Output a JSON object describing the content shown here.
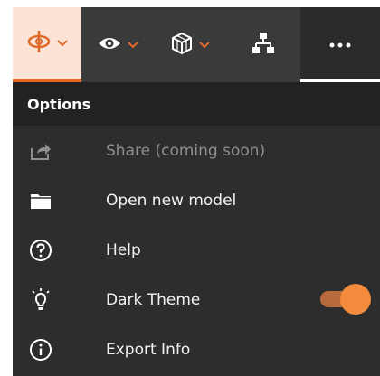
{
  "toolbar": {
    "tools": [
      {
        "icon": "orbit-icon",
        "has_dropdown": true,
        "active": true
      },
      {
        "icon": "eye-icon",
        "has_dropdown": true
      },
      {
        "icon": "cube-icon",
        "has_dropdown": true
      },
      {
        "icon": "hierarchy-icon",
        "has_dropdown": false
      },
      {
        "icon": "more-icon",
        "has_dropdown": false,
        "selected": true
      }
    ],
    "accent_color": "#e06a2c"
  },
  "options": {
    "title": "Options",
    "items": [
      {
        "label": "Share (coming soon)",
        "icon": "share-icon",
        "disabled": true
      },
      {
        "label": "Open new model",
        "icon": "folder-icon"
      },
      {
        "label": "Help",
        "icon": "help-icon"
      },
      {
        "label": "Dark Theme",
        "icon": "lightbulb-icon",
        "toggle_on": true
      },
      {
        "label": "Export Info",
        "icon": "info-icon"
      }
    ]
  }
}
